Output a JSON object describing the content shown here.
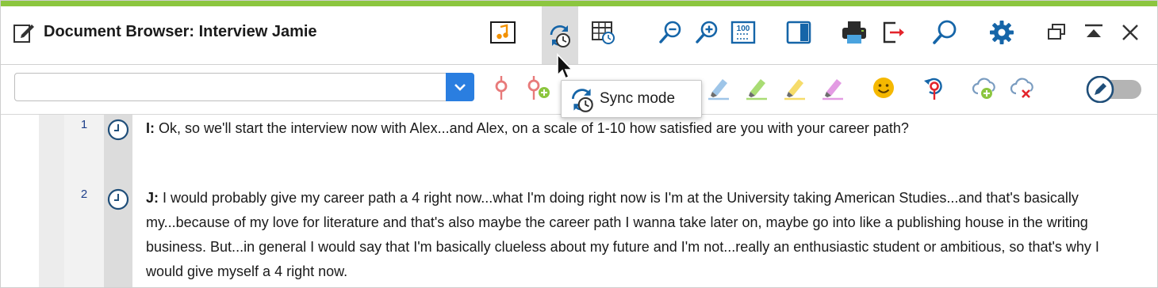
{
  "window": {
    "title": "Document Browser: Interview Jamie",
    "accent_color": "#8cc63f",
    "icon_blue": "#1565a8"
  },
  "titlebar": {
    "buttons": [
      {
        "name": "media-player-icon"
      },
      {
        "name": "sync-mode-icon",
        "active": true
      },
      {
        "name": "timestamps-table-icon"
      },
      {
        "name": "zoom-out-icon"
      },
      {
        "name": "zoom-in-icon"
      },
      {
        "name": "zoom-100-icon"
      },
      {
        "name": "panel-toggle-icon"
      },
      {
        "name": "print-icon"
      },
      {
        "name": "export-icon"
      },
      {
        "name": "search-icon"
      },
      {
        "name": "settings-gear-icon"
      },
      {
        "name": "undock-window-icon"
      },
      {
        "name": "collapse-icon"
      },
      {
        "name": "close-icon"
      }
    ]
  },
  "toolbar": {
    "search_value": "",
    "icons": [
      "code-pin-icon",
      "add-code-pin-icon",
      "highlight-blue-icon",
      "highlight-green-icon",
      "highlight-yellow-icon",
      "highlight-purple-icon",
      "emoticon-icon",
      "undo-code-icon",
      "cloud-add-icon",
      "cloud-remove-icon",
      "edit-mode-toggle-icon"
    ]
  },
  "tooltip": {
    "label": "Sync mode"
  },
  "document": {
    "paragraphs": [
      {
        "number": "1",
        "speaker": "I:",
        "text": " Ok, so we'll start the interview now with Alex...and Alex, on a scale of 1-10 how satisfied are you with your career path?"
      },
      {
        "number": "2",
        "speaker": "J:",
        "text": " I would probably give my career path a 4 right now...what I'm doing right now is I'm at the University taking American Studies...and that's basically my...because of my love for literature and that's also maybe the career path I wanna take later on, maybe go into like a publishing house in the writing business. But...in general I would say that I'm basically clueless about my future and I'm not...really an enthusiastic student or ambitious, so that's why I would give myself a 4 right now."
      }
    ]
  }
}
